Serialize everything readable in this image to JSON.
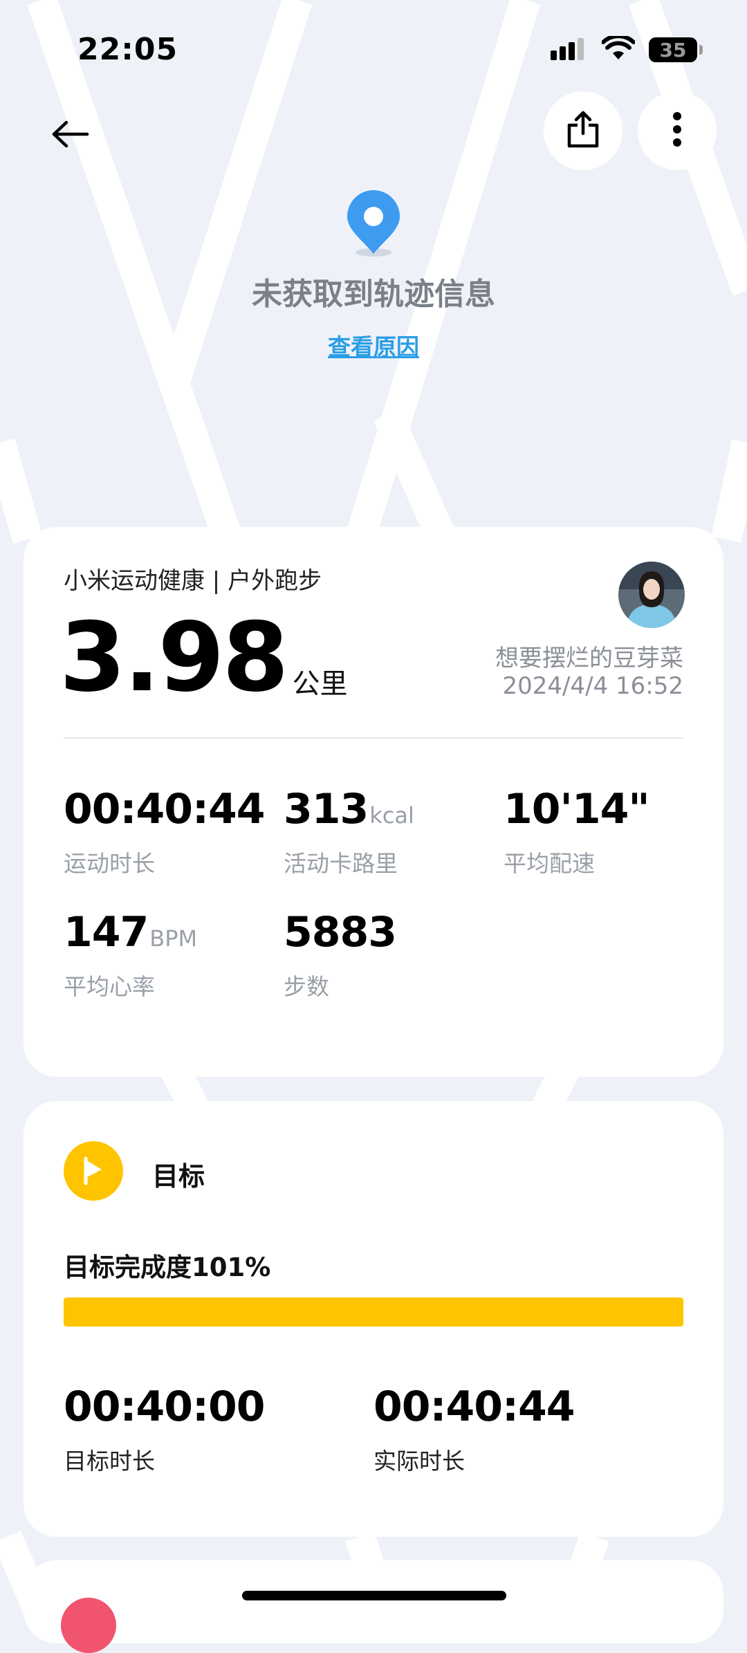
{
  "status_bar": {
    "time": "22:05",
    "battery": "35"
  },
  "no_track": {
    "message": "未获取到轨迹信息",
    "link": "查看原因"
  },
  "summary": {
    "source": "小米运动健康 | 户外跑步",
    "distance": "3.98",
    "distance_unit": "公里",
    "user_name": "想要摆烂的豆芽菜",
    "datetime": "2024/4/4 16:52",
    "metrics": [
      {
        "value": "00:40:44",
        "unit": "",
        "label": "运动时长"
      },
      {
        "value": "313",
        "unit": "kcal",
        "label": "活动卡路里"
      },
      {
        "value": "10'14\"",
        "unit": "",
        "label": "平均配速"
      },
      {
        "value": "147",
        "unit": "BPM",
        "label": "平均心率"
      },
      {
        "value": "5883",
        "unit": "",
        "label": "步数"
      }
    ]
  },
  "goal": {
    "title": "目标",
    "progress_label": "目标完成度101%",
    "progress_fraction": 1.0,
    "target_value": "00:40:00",
    "target_label": "目标时长",
    "actual_value": "00:40:44",
    "actual_label": "实际时长"
  },
  "colors": {
    "accent_yellow": "#ffc400",
    "link_blue": "#2b9ee6",
    "pin_blue": "#3d9bf0",
    "background": "#eef2f8"
  },
  "icons": {
    "back": "arrow-left-icon",
    "share": "share-icon",
    "more": "more-vertical-icon",
    "pin": "location-pin-icon",
    "goal": "play-flag-icon"
  }
}
